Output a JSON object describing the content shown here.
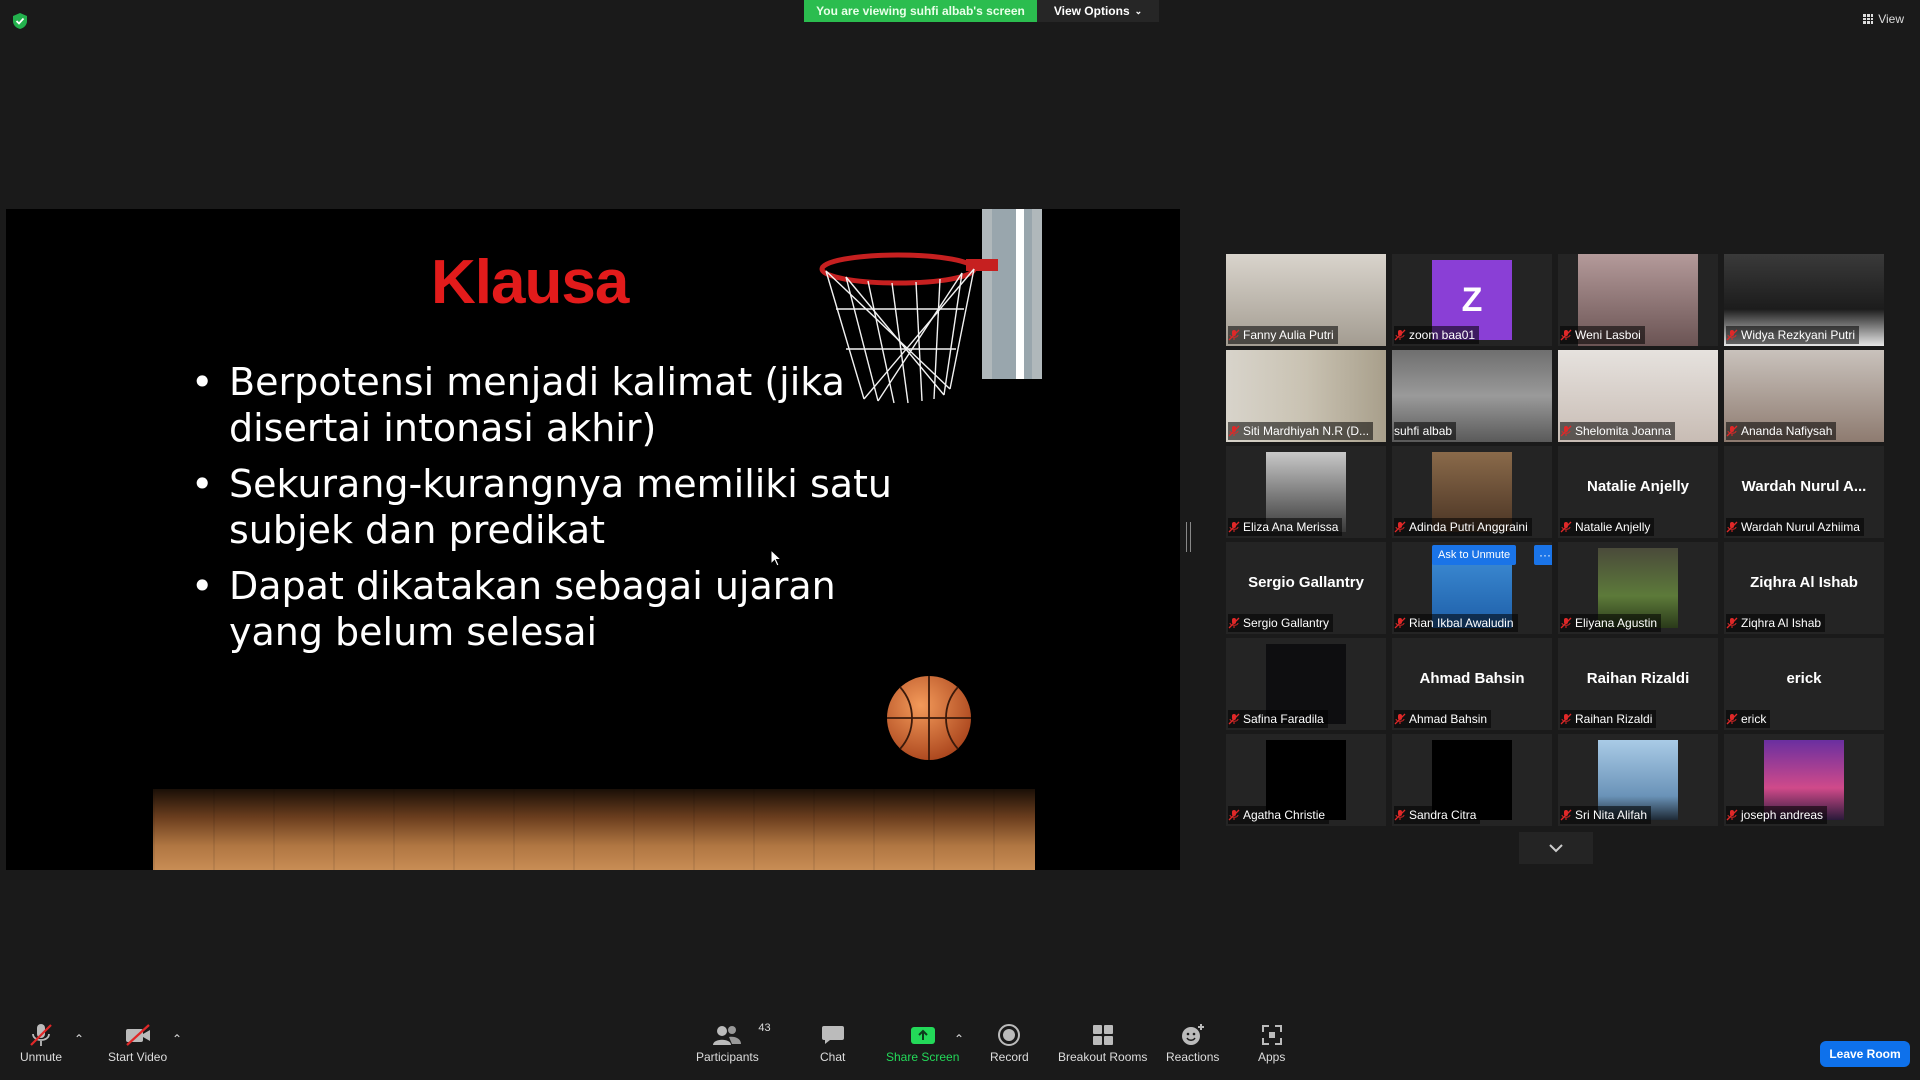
{
  "top": {
    "banner": "You are viewing suhfi albab's screen",
    "view_options": "View Options",
    "view_label": "View"
  },
  "slide": {
    "title": "Klausa",
    "bullets": [
      "Berpotensi menjadi kalimat (jika disertai intonasi akhir)",
      "Sekurang-kurangnya memiliki satu subjek dan predikat",
      "Dapat dikatakan sebagai ujaran yang belum selesai"
    ]
  },
  "participants": [
    {
      "name": "Fanny Aulia Putri",
      "label": "Fanny Aulia Putri"
    },
    {
      "name": "zoom baa01",
      "label": "zoom baa01",
      "avatar": "Z"
    },
    {
      "name": "Weni Lasboi",
      "label": "Weni Lasboi"
    },
    {
      "name": "Widya Rezkyani Putri",
      "label": "Widya Rezkyani Putri"
    },
    {
      "name": "Siti Mardhiyah N.R",
      "label": "Siti Mardhiyah N.R (D..."
    },
    {
      "name": "suhfi albab",
      "label": "suhfi albab"
    },
    {
      "name": "Shelomita Joanna",
      "label": "Shelomita Joanna"
    },
    {
      "name": "Ananda Nafiysah",
      "label": "Ananda Nafiysah"
    },
    {
      "name": "Eliza Ana Merissa",
      "label": "Eliza Ana Merissa"
    },
    {
      "name": "Adinda Putri Anggraini",
      "label": "Adinda Putri Anggraini"
    },
    {
      "name": "Natalie Anjelly",
      "label": "Natalie Anjelly",
      "bigname": "Natalie Anjelly"
    },
    {
      "name": "Wardah Nurul Azhiima",
      "label": "Wardah Nurul Azhiima",
      "bigname": "Wardah Nurul A..."
    },
    {
      "name": "Sergio Gallantry",
      "label": "Sergio Gallantry",
      "bigname": "Sergio Gallantry"
    },
    {
      "name": "Rian Ikbal Awaludin",
      "label": "Rian Ikbal Awaludin"
    },
    {
      "name": "Eliyana Agustin",
      "label": "Eliyana Agustin"
    },
    {
      "name": "Ziqhra Al Ishab",
      "label": "Ziqhra Al Ishab",
      "bigname": "Ziqhra Al Ishab"
    },
    {
      "name": "Safina Faradila",
      "label": "Safina Faradila"
    },
    {
      "name": "Ahmad Bahsin",
      "label": "Ahmad Bahsin",
      "bigname": "Ahmad Bahsin"
    },
    {
      "name": "Raihan Rizaldi",
      "label": "Raihan Rizaldi",
      "bigname": "Raihan Rizaldi"
    },
    {
      "name": "erick",
      "label": "erick",
      "bigname": "erick"
    },
    {
      "name": "Agatha Christie",
      "label": "Agatha Christie"
    },
    {
      "name": "Sandra Citra",
      "label": "Sandra Citra"
    },
    {
      "name": "Sri Nita Alifah",
      "label": "Sri Nita Alifah"
    },
    {
      "name": "joseph andreas",
      "label": "joseph andreas"
    }
  ],
  "tile_actions": {
    "ask_to_unmute": "Ask to Unmute",
    "more": "···"
  },
  "toolbar": {
    "unmute": "Unmute",
    "start_video": "Start Video",
    "participants": "Participants",
    "participants_count": "43",
    "chat": "Chat",
    "share_screen": "Share Screen",
    "record": "Record",
    "breakout_rooms": "Breakout Rooms",
    "reactions": "Reactions",
    "apps": "Apps",
    "leave_room": "Leave Room"
  },
  "colors": {
    "banner": "#2bbd4f",
    "slide_title": "#e21b1b",
    "active_speaker": "#c9e265",
    "leave_button": "#0e71eb",
    "mute_icon": "#e02828"
  }
}
